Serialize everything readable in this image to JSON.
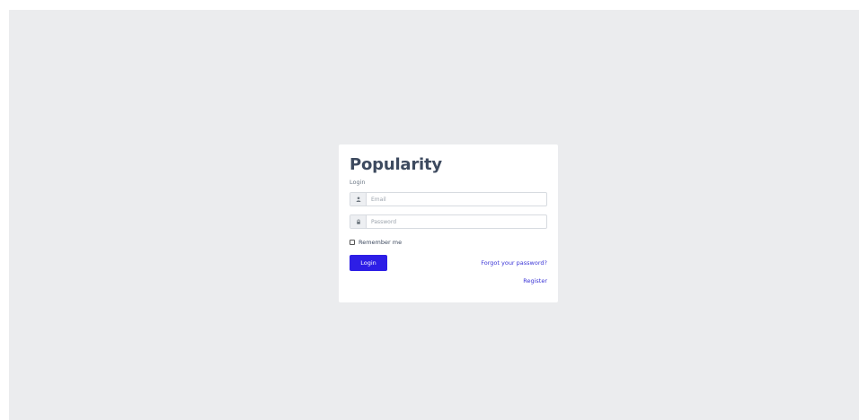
{
  "login_card": {
    "title": "Popularity",
    "subtitle": "Login",
    "email": {
      "placeholder": "Email",
      "value": "",
      "icon": "user-icon"
    },
    "password": {
      "placeholder": "Password",
      "value": "",
      "icon": "lock-icon"
    },
    "remember_label": "Remember me",
    "remember_checked": false,
    "login_button_label": "Login",
    "forgot_link_label": "Forgot your password?",
    "register_link_label": "Register"
  },
  "colors": {
    "page_background": "#ebecee",
    "card_background": "#ffffff",
    "primary_button": "#2d1ee6",
    "link": "#3b35d6",
    "title_text": "#3d4a5f"
  }
}
